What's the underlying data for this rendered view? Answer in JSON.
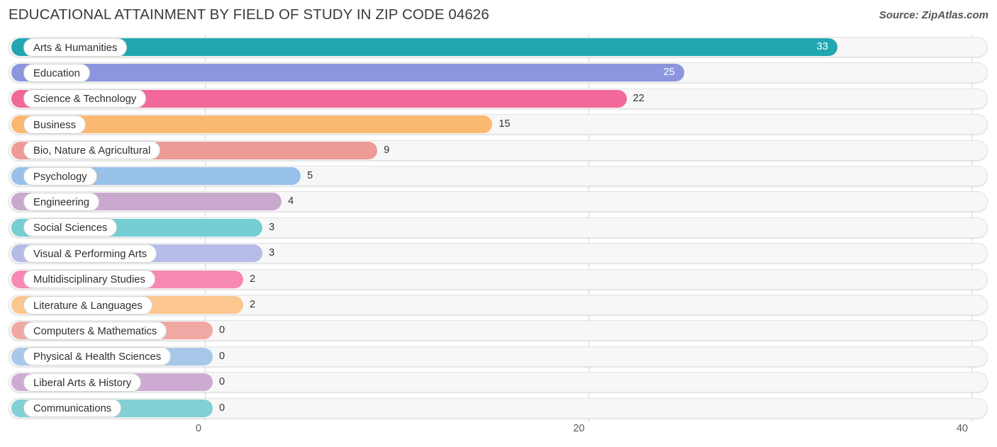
{
  "header": {
    "title": "EDUCATIONAL ATTAINMENT BY FIELD OF STUDY IN ZIP CODE 04626",
    "source": "Source: ZipAtlas.com"
  },
  "chart_data": {
    "type": "bar",
    "orientation": "horizontal",
    "title": "EDUCATIONAL ATTAINMENT BY FIELD OF STUDY IN ZIP CODE 04626",
    "subtitle": "",
    "xlabel": "",
    "ylabel": "",
    "xlim": [
      0,
      40
    ],
    "ylim": null,
    "grid": true,
    "legend": null,
    "xticks": [
      0,
      20,
      40
    ],
    "xtick_labels": [
      "0",
      "20",
      "40"
    ],
    "categories": [
      "Arts & Humanities",
      "Education",
      "Science & Technology",
      "Business",
      "Bio, Nature & Agricultural",
      "Psychology",
      "Engineering",
      "Social Sciences",
      "Visual & Performing Arts",
      "Multidisciplinary Studies",
      "Literature & Languages",
      "Computers & Mathematics",
      "Physical & Health Sciences",
      "Liberal Arts & History",
      "Communications"
    ],
    "values": [
      33,
      25,
      22,
      15,
      9,
      5,
      4,
      3,
      3,
      2,
      2,
      0,
      0,
      0,
      0
    ],
    "value_labels": [
      "33",
      "25",
      "22",
      "15",
      "9",
      "5",
      "4",
      "3",
      "3",
      "2",
      "2",
      "0",
      "0",
      "0",
      "0"
    ],
    "colors": [
      "#21a7b1",
      "#8b96de",
      "#f2689a",
      "#fbb871",
      "#ed9b96",
      "#97c1e8",
      "#c9a9ce",
      "#74ced3",
      "#b5bce8",
      "#f789b4",
      "#fbc68f",
      "#f0a8a4",
      "#a8c8ea",
      "#ceabd3",
      "#81d0d4"
    ]
  }
}
